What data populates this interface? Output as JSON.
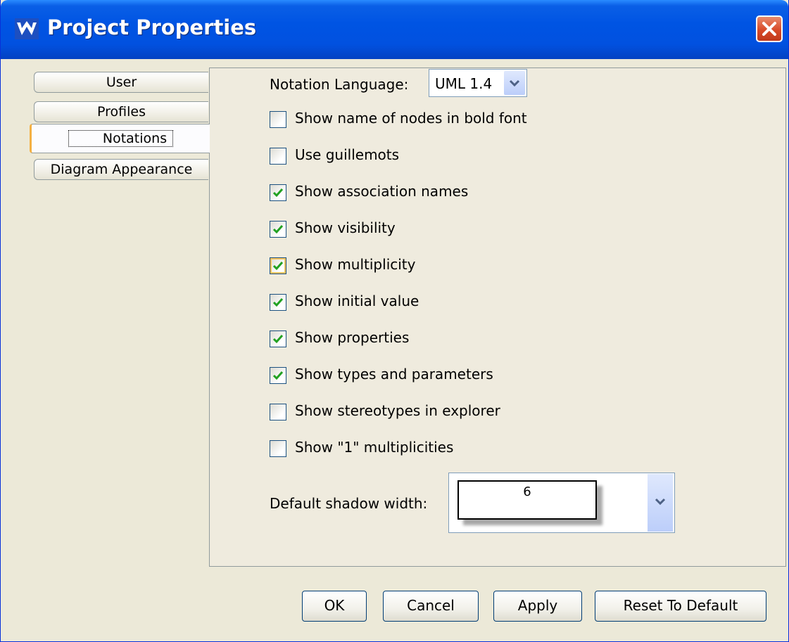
{
  "window": {
    "title": "Project Properties"
  },
  "tabs": [
    {
      "label": "User",
      "selected": false
    },
    {
      "label": "Profiles",
      "selected": false
    },
    {
      "label": "Notations",
      "selected": true
    },
    {
      "label": "Diagram Appearance",
      "selected": false
    }
  ],
  "notation": {
    "label": "Notation Language:",
    "value": "UML 1.4"
  },
  "options": [
    {
      "label": "Show name of nodes in bold font",
      "checked": false
    },
    {
      "label": "Use guillemots",
      "checked": false
    },
    {
      "label": "Show association names",
      "checked": true
    },
    {
      "label": "Show visibility",
      "checked": true
    },
    {
      "label": "Show multiplicity",
      "checked": true
    },
    {
      "label": "Show initial value",
      "checked": true
    },
    {
      "label": "Show properties",
      "checked": true
    },
    {
      "label": "Show types and parameters",
      "checked": true
    },
    {
      "label": "Show stereotypes in explorer",
      "checked": false
    },
    {
      "label": "Show \"1\" multiplicities",
      "checked": false
    }
  ],
  "shadow": {
    "label": "Default shadow width:",
    "value": "6"
  },
  "buttons": {
    "ok": "OK",
    "cancel": "Cancel",
    "apply": "Apply",
    "reset": "Reset To Default"
  },
  "colors": {
    "title_bar": "#0054e3",
    "dialog_bg": "#ece9d8",
    "check_mark": "#21a121",
    "close_button": "#d84a28"
  }
}
